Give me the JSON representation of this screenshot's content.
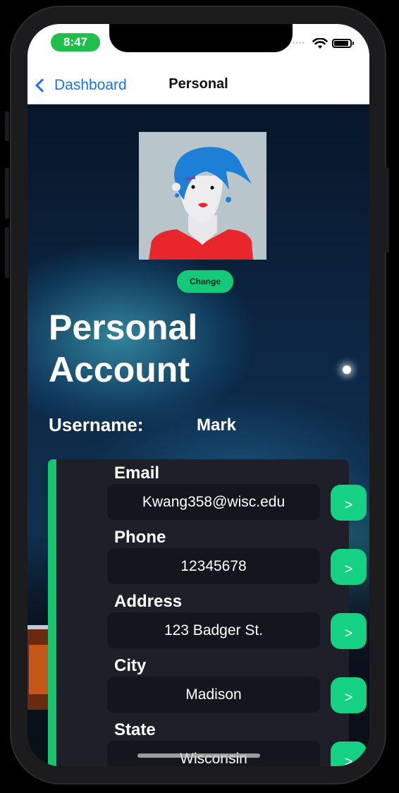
{
  "status_bar": {
    "time": "8:47"
  },
  "nav": {
    "back_label": "Dashboard",
    "title": "Personal"
  },
  "profile": {
    "change_label": "Change"
  },
  "page": {
    "title": "Personal Account"
  },
  "username": {
    "label": "Username:",
    "value": "Mark"
  },
  "fields": [
    {
      "label": "Email",
      "value": "Kwang358@wisc.edu",
      "button": ">"
    },
    {
      "label": "Phone",
      "value": "12345678",
      "button": ">"
    },
    {
      "label": "Address",
      "value": "123 Badger St.",
      "button": ">"
    },
    {
      "label": "City",
      "value": "Madison",
      "button": ">"
    },
    {
      "label": "State",
      "value": "Wisconsin",
      "button": ">"
    }
  ],
  "colors": {
    "accent_green": "#14d183",
    "ios_blue": "#1a73e8",
    "card_bg": "#1e1f29"
  }
}
